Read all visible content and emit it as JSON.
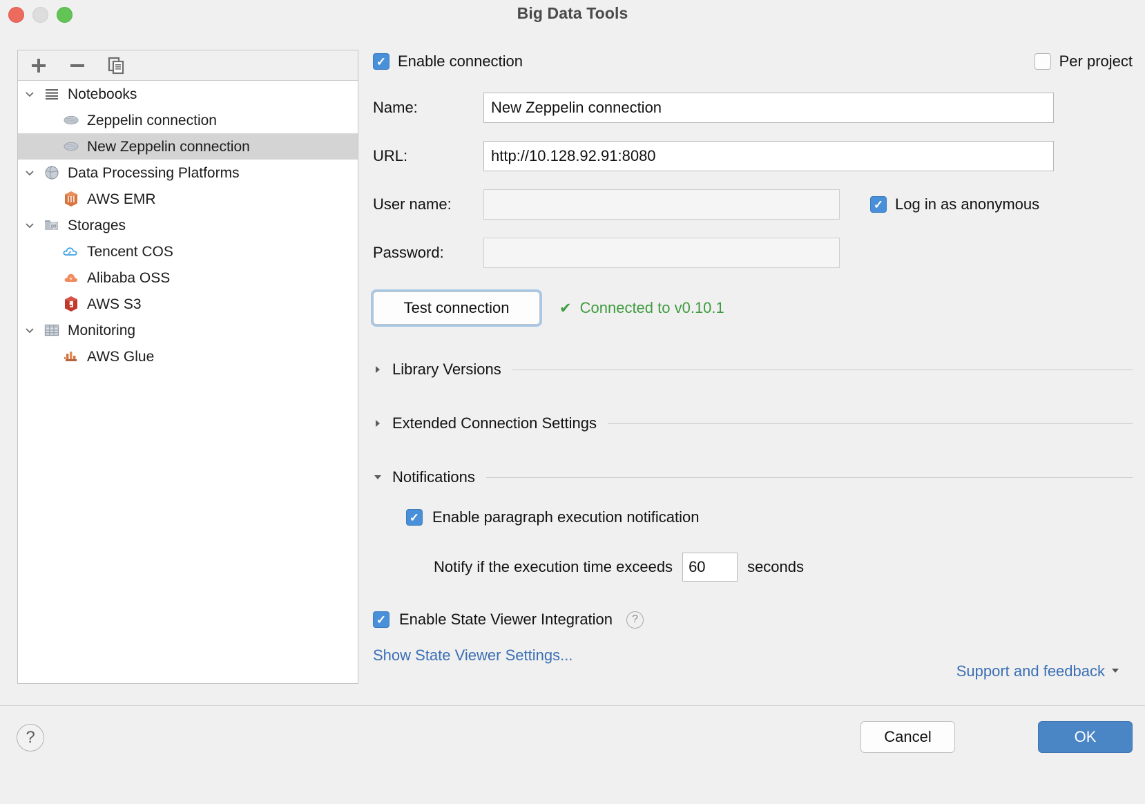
{
  "window": {
    "title": "Big Data Tools"
  },
  "sidebar": {
    "toolbar": {
      "add_label": "+",
      "remove_label": "−",
      "copy_label": "copy-icon"
    },
    "items": [
      {
        "label": "Notebooks",
        "icon": "list-icon",
        "level": 0,
        "expanded": true,
        "selected": false
      },
      {
        "label": "Zeppelin connection",
        "icon": "zeppelin-icon",
        "level": 1,
        "selected": false
      },
      {
        "label": "New Zeppelin connection",
        "icon": "zeppelin-icon",
        "level": 1,
        "selected": true
      },
      {
        "label": "Data Processing Platforms",
        "icon": "globe-icon",
        "level": 0,
        "expanded": true,
        "selected": false
      },
      {
        "label": "AWS EMR",
        "icon": "aws-emr-icon",
        "level": 1,
        "selected": false
      },
      {
        "label": "Storages",
        "icon": "storages-icon",
        "level": 0,
        "expanded": true,
        "selected": false
      },
      {
        "label": "Tencent COS",
        "icon": "tencent-cos-icon",
        "level": 1,
        "selected": false
      },
      {
        "label": "Alibaba OSS",
        "icon": "alibaba-oss-icon",
        "level": 1,
        "selected": false
      },
      {
        "label": "AWS S3",
        "icon": "aws-s3-icon",
        "level": 1,
        "selected": false
      },
      {
        "label": "Monitoring",
        "icon": "table-icon",
        "level": 0,
        "expanded": true,
        "selected": false
      },
      {
        "label": "AWS Glue",
        "icon": "aws-glue-icon",
        "level": 1,
        "selected": false
      }
    ]
  },
  "form": {
    "enable_connection_label": "Enable connection",
    "enable_connection_checked": true,
    "per_project_label": "Per project",
    "per_project_checked": false,
    "name_label": "Name:",
    "name_value": "New Zeppelin connection",
    "url_label": "URL:",
    "url_value": "http://10.128.92.91:8080",
    "username_label": "User name:",
    "username_value": "",
    "password_label": "Password:",
    "password_value": "",
    "anonymous_label": "Log in as anonymous",
    "anonymous_checked": true,
    "test_connection_label": "Test connection",
    "status_text": "Connected to v0.10.1",
    "status_icon": "check-icon",
    "status_color": "#3e9b3e"
  },
  "sections": {
    "library_versions": {
      "label": "Library Versions",
      "expanded": false
    },
    "extended_connection": {
      "label": "Extended Connection Settings",
      "expanded": false
    },
    "notifications": {
      "label": "Notifications",
      "expanded": true
    }
  },
  "notifications": {
    "enable_paragraph_label": "Enable paragraph execution notification",
    "enable_paragraph_checked": true,
    "notify_prefix": "Notify if the execution time exceeds",
    "notify_seconds": "60",
    "notify_suffix": "seconds"
  },
  "state_viewer": {
    "label": "Enable State Viewer Integration",
    "checked": true,
    "help_icon": "question-mark-icon",
    "settings_link": "Show State Viewer Settings..."
  },
  "footer": {
    "support_link": "Support and feedback",
    "support_caret": "chevron-down-icon",
    "help_label": "?",
    "cancel_label": "Cancel",
    "ok_label": "OK"
  },
  "colors": {
    "accent": "#4a90d9",
    "link": "#3b6fb5",
    "success": "#3e9b3e",
    "ok_button": "#4a85c5"
  }
}
